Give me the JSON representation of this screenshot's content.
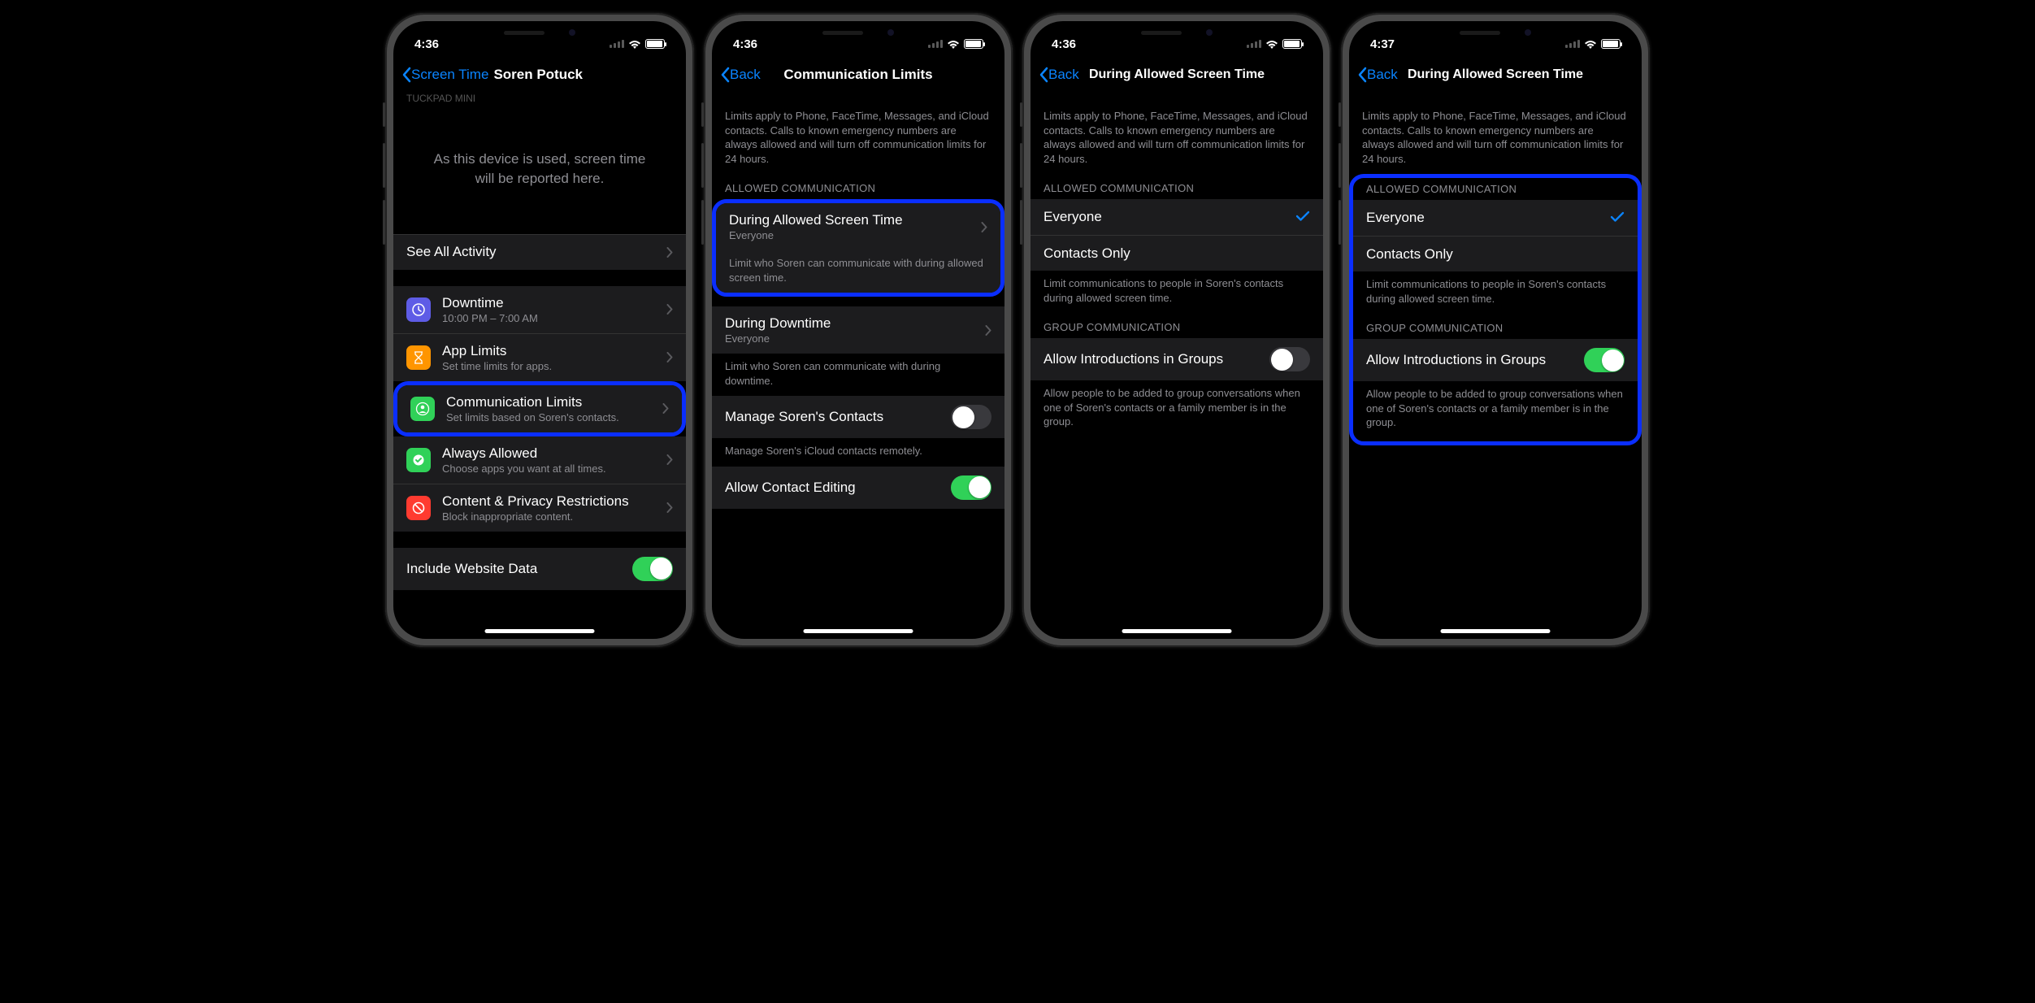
{
  "status": {
    "time1": "4:36",
    "time2": "4:36",
    "time3": "4:36",
    "time4": "4:37"
  },
  "s1": {
    "back": "Screen Time",
    "title": "Soren Potuck",
    "deviceHeader": "TUCKPAD MINI",
    "usageMsg": "As this device is used, screen time will be reported here.",
    "seeAll": "See All Activity",
    "rows": {
      "downtime": {
        "t": "Downtime",
        "s": "10:00 PM – 7:00 AM"
      },
      "applimits": {
        "t": "App Limits",
        "s": "Set time limits for apps."
      },
      "comm": {
        "t": "Communication Limits",
        "s": "Set limits based on Soren's contacts."
      },
      "always": {
        "t": "Always Allowed",
        "s": "Choose apps you want at all times."
      },
      "content": {
        "t": "Content & Privacy Restrictions",
        "s": "Block inappropriate content."
      }
    },
    "websiteData": "Include Website Data"
  },
  "s2": {
    "back": "Back",
    "title": "Communication Limits",
    "desc": "Limits apply to Phone, FaceTime, Messages, and iCloud contacts. Calls to known emergency numbers are always allowed and will turn off communication limits for 24 hours.",
    "header1": "ALLOWED COMMUNICATION",
    "during": {
      "t": "During Allowed Screen Time",
      "s": "Everyone"
    },
    "duringFooter": "Limit who Soren can communicate with during allowed screen time.",
    "downtime": {
      "t": "During Downtime",
      "s": "Everyone"
    },
    "downtimeFooter": "Limit who Soren can communicate with during downtime.",
    "manage": "Manage Soren's Contacts",
    "manageFooter": "Manage Soren's iCloud contacts remotely.",
    "allowEdit": "Allow Contact Editing"
  },
  "s3": {
    "back": "Back",
    "title": "During Allowed Screen Time",
    "desc": "Limits apply to Phone, FaceTime, Messages, and iCloud contacts. Calls to known emergency numbers are always allowed and will turn off communication limits for 24 hours.",
    "header1": "ALLOWED COMMUNICATION",
    "everyone": "Everyone",
    "contactsOnly": "Contacts Only",
    "footer1": "Limit communications to people in Soren's contacts during allowed screen time.",
    "header2": "GROUP COMMUNICATION",
    "groupToggle": "Allow Introductions in Groups",
    "footer2": "Allow people to be added to group conversations when one of Soren's contacts or a family member is in the group."
  }
}
